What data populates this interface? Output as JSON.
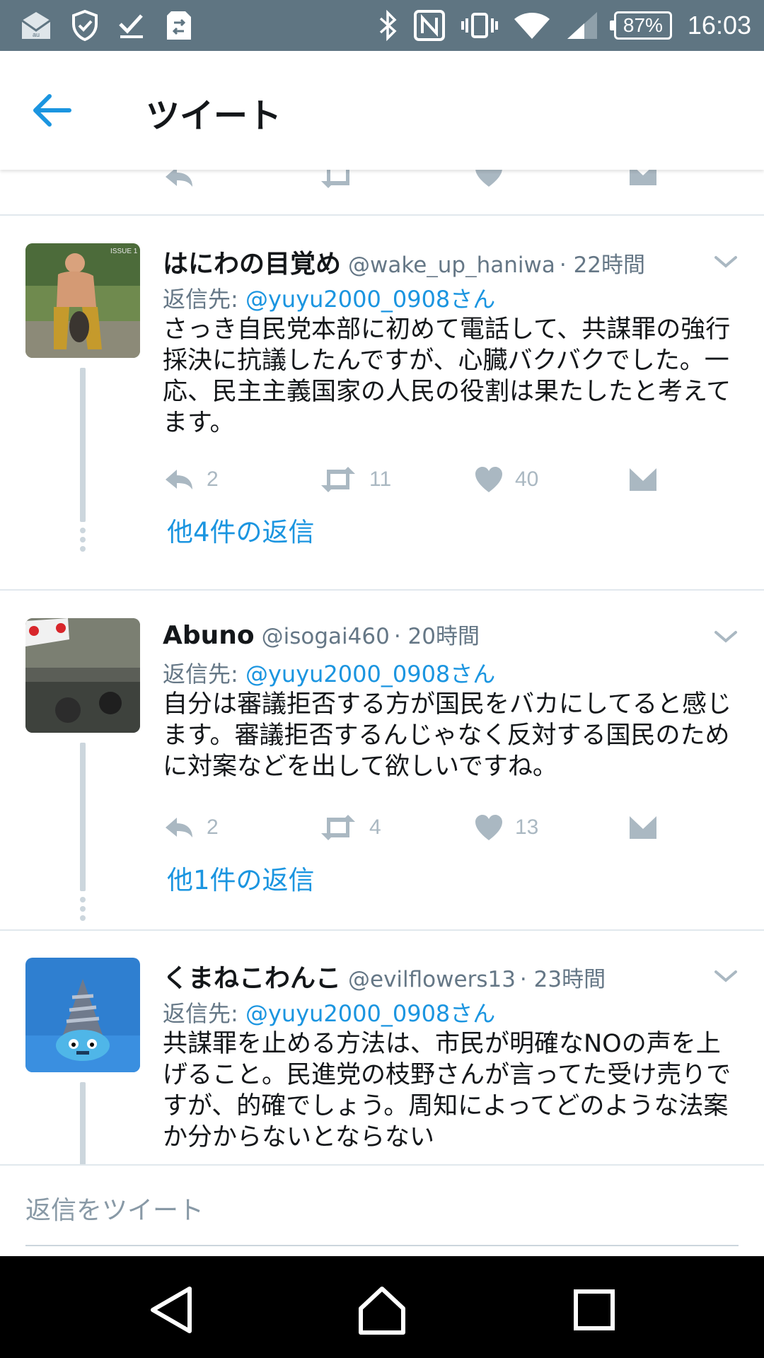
{
  "status_bar": {
    "battery": "87%",
    "time": "16:03"
  },
  "app_bar": {
    "title": "ツイート"
  },
  "tweets": [
    {
      "name": "はにわの目覚め",
      "handle": "@wake_up_haniwa",
      "time": "· 22時間",
      "reply_to_label": "返信先: ",
      "reply_to_mention": "@yuyu2000_0908さん",
      "text": "さっき自民党本部に初めて電話して、共謀罪の強行採決に抗議したんですが、心臓バクバクでした。一応、民主主義国家の人民の役割は果たしたと考えてます。",
      "reply_count": "2",
      "retweet_count": "11",
      "like_count": "40",
      "more_replies": "他4件の返信"
    },
    {
      "name": "Abuno",
      "handle": "@isogai460",
      "time": "· 20時間",
      "reply_to_label": "返信先: ",
      "reply_to_mention": "@yuyu2000_0908さん",
      "text": "自分は審議拒否する方が国民をバカにしてると感じます。審議拒否するんじゃなく反対する国民のために対案などを出して欲しいですね。",
      "reply_count": "2",
      "retweet_count": "4",
      "like_count": "13",
      "more_replies": "他1件の返信"
    },
    {
      "name": "くまねこわんこ",
      "handle": "@evilflowers13",
      "time": "· 23時間",
      "reply_to_label": "返信先: ",
      "reply_to_mention": "@yuyu2000_0908さん",
      "text": "共謀罪を止める方法は、市民が明確なNOの声を上げること。民進党の枝野さんが言ってた受け売りですが、的確でしょう。周知によってどのような法案か分からないとならない"
    }
  ],
  "composer": {
    "placeholder": "返信をツイート"
  },
  "colors": {
    "status_bar_bg": "#5f7582",
    "accent": "#1b95e0",
    "secondary_text": "#657786",
    "icon_gray": "#aab8c2"
  }
}
